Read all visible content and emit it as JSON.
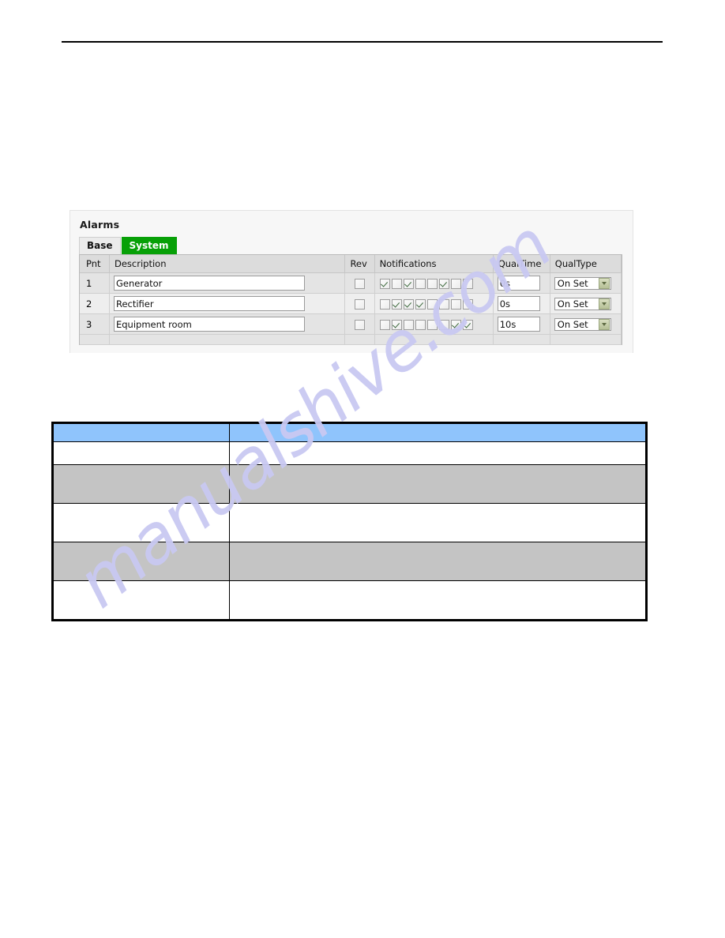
{
  "page": {
    "watermark_text": "manualshive.com",
    "watermark_color": "#c9c9f2"
  },
  "alarms_panel": {
    "title": "Alarms",
    "tabs": [
      {
        "label": "Base",
        "active": false
      },
      {
        "label": "System",
        "active": true
      }
    ],
    "active_tab_color": "#07a007",
    "table": {
      "headers": {
        "pnt": "Pnt",
        "description": "Description",
        "rev": "Rev",
        "notifications": "Notifications",
        "qualtime": "QualTime",
        "qualtype": "QualType"
      },
      "notification_count": 8,
      "rows": [
        {
          "pnt": "1",
          "description": "Generator",
          "rev_checked": false,
          "notifications": [
            true,
            false,
            true,
            false,
            false,
            true,
            false,
            false
          ],
          "qualtime": "0s",
          "qualtype": "On Set"
        },
        {
          "pnt": "2",
          "description": "Rectifier",
          "rev_checked": false,
          "notifications": [
            false,
            true,
            true,
            true,
            false,
            false,
            false,
            false
          ],
          "qualtime": "0s",
          "qualtype": "On Set"
        },
        {
          "pnt": "3",
          "description": "Equipment room",
          "rev_checked": false,
          "notifications": [
            false,
            true,
            false,
            false,
            false,
            false,
            true,
            true
          ],
          "qualtime": "10s",
          "qualtype": "On Set"
        }
      ]
    }
  },
  "description_table": {
    "header_color": "#8fc4fc",
    "shaded_row_color": "#c4c4c4",
    "columns": [
      "",
      ""
    ],
    "rows": [
      {
        "shaded": false,
        "height": "h1",
        "cells": [
          "",
          ""
        ]
      },
      {
        "shaded": true,
        "height": "h2",
        "cells": [
          "",
          ""
        ]
      },
      {
        "shaded": false,
        "height": "h2",
        "cells": [
          "",
          ""
        ]
      },
      {
        "shaded": true,
        "height": "h2",
        "cells": [
          "",
          ""
        ]
      },
      {
        "shaded": false,
        "height": "h2",
        "cells": [
          "",
          ""
        ]
      }
    ]
  }
}
